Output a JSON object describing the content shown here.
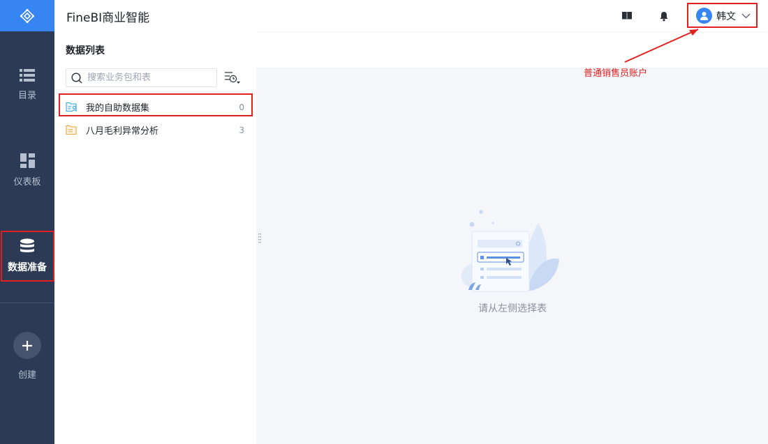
{
  "app": {
    "title": "FineBI商业智能"
  },
  "nav": {
    "items": [
      {
        "label": "目录",
        "icon": "list-icon"
      },
      {
        "label": "仪表板",
        "icon": "dashboard-icon"
      },
      {
        "label": "数据准备",
        "icon": "database-icon",
        "active": true
      },
      {
        "label": "创建",
        "icon": "plus-icon"
      }
    ]
  },
  "header": {
    "user": {
      "name": "韩文"
    }
  },
  "data_list": {
    "title": "数据列表",
    "search_placeholder": "搜索业务包和表",
    "items": [
      {
        "name": "我的自助数据集",
        "count": "0",
        "icon": "self-dataset-folder-icon"
      },
      {
        "name": "八月毛利异常分析",
        "count": "3",
        "icon": "folder-icon"
      }
    ]
  },
  "content": {
    "empty_text": "请从左侧选择表"
  },
  "annotation": {
    "text": "普通销售员账户"
  },
  "colors": {
    "rail": "#2c3a55",
    "accent": "#3685f2",
    "annotation": "#e02020",
    "content_bg": "#f5f6f9"
  }
}
